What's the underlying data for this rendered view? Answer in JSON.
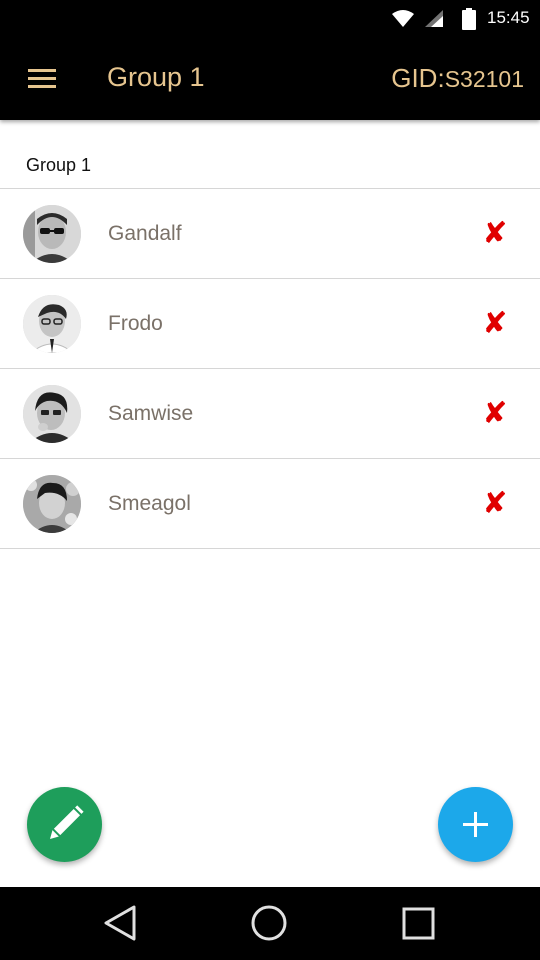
{
  "status_bar": {
    "time": "15:45",
    "icons": [
      "wifi-icon",
      "cell-signal-icon",
      "battery-icon"
    ]
  },
  "app_bar": {
    "title": "Group 1",
    "gid_label": "GID:",
    "gid_value": "S32101",
    "menu_icon": "hamburger-menu-icon"
  },
  "section": {
    "title": "Group 1"
  },
  "members": [
    {
      "name": "Gandalf",
      "remove_icon": "✘"
    },
    {
      "name": "Frodo",
      "remove_icon": "✘"
    },
    {
      "name": "Samwise",
      "remove_icon": "✘"
    },
    {
      "name": "Smeagol",
      "remove_icon": "✘"
    }
  ],
  "fabs": {
    "edit_icon": "pencil-icon",
    "add_icon": "plus-icon"
  },
  "nav_bar": {
    "icons": [
      "back-icon",
      "home-icon",
      "recent-apps-icon"
    ]
  },
  "colors": {
    "app_bar_bg": "#000000",
    "accent_gold": "#e6c58f",
    "member_name": "#7a7168",
    "remove_red": "#e00000",
    "fab_edit": "#1e9e5b",
    "fab_add": "#1ca8ea"
  }
}
